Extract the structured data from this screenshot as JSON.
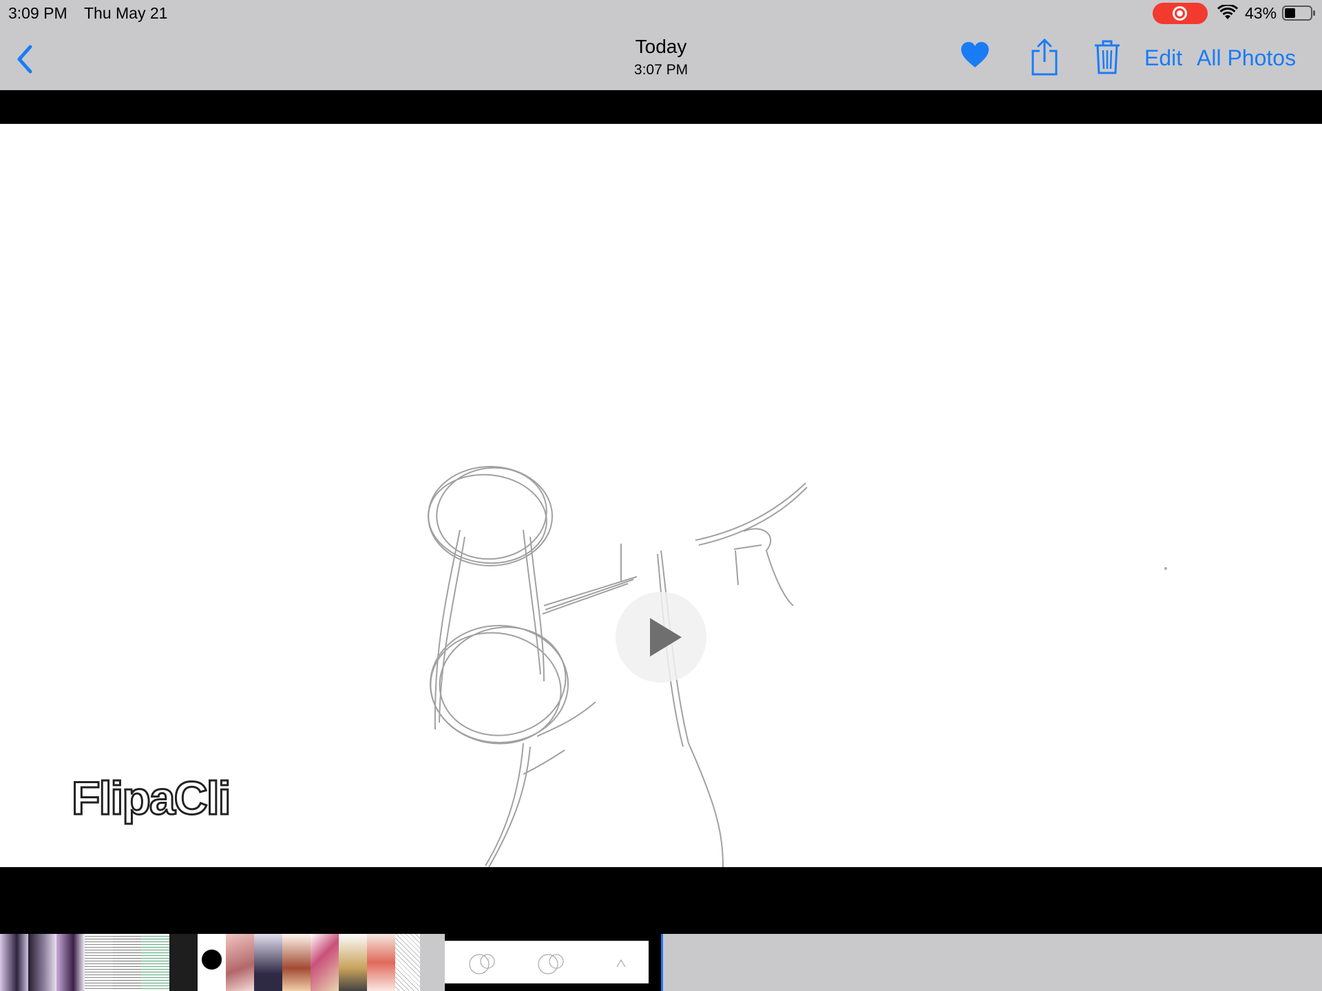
{
  "status_bar": {
    "time": "3:09 PM",
    "date": "Thu May 21",
    "battery_percent": "43%",
    "battery_level": 0.43,
    "recording": true,
    "icons": [
      "screen-recording-icon",
      "wifi-icon",
      "battery-icon"
    ]
  },
  "nav": {
    "back_icon": "chevron-left-icon",
    "title": "Today",
    "subtitle": "3:07 PM",
    "favorite_icon": "heart-icon",
    "favorited": true,
    "share_icon": "share-icon",
    "delete_icon": "trash-icon",
    "edit_label": "Edit",
    "all_photos_label": "All Photos"
  },
  "viewer": {
    "content": "sketch video",
    "watermark": "FlipaClip",
    "play_icon": "play-icon"
  },
  "filmstrip": {
    "selected_index": 1,
    "colors": {
      "accent": "#1a7cf5",
      "bar": "#c9c9cc",
      "record": "#f23a2f"
    }
  }
}
